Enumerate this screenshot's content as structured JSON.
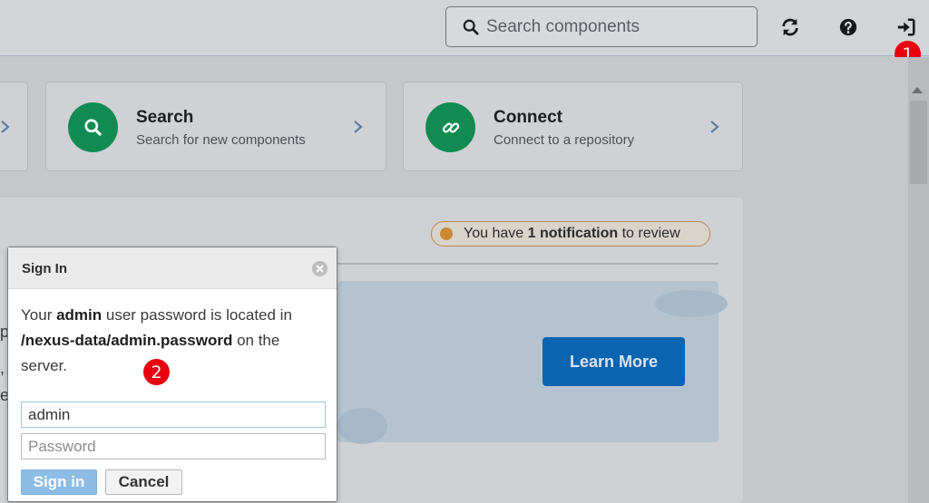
{
  "header": {
    "search_placeholder": "Search components",
    "refresh_icon": "refresh-icon",
    "help_icon": "help-icon",
    "signin_icon": "sign-in-icon"
  },
  "annotations": {
    "badge_1": "1",
    "badge_2": "2"
  },
  "cards": [
    {
      "title": "Search",
      "subtitle": "Search for new components",
      "icon": "search-icon"
    },
    {
      "title": "Connect",
      "subtitle": "Connect to a repository",
      "icon": "link-icon"
    }
  ],
  "notification": {
    "prefix": "You have ",
    "bold": "1 notification",
    "suffix": " to review"
  },
  "banner": {
    "learn_more": "Learn More"
  },
  "dialog": {
    "title": "Sign In",
    "msg_1": "Your ",
    "msg_user": "admin",
    "msg_2": " user password is located in ",
    "msg_path": "/nexus-data/admin.password",
    "msg_3": " on the server.",
    "username_value": "admin",
    "password_placeholder": "Password",
    "signin_label": "Sign in",
    "cancel_label": "Cancel"
  },
  "colors": {
    "accent_green": "#118b53",
    "primary_blue": "#0a64b0",
    "badge_red": "#e8000f"
  }
}
